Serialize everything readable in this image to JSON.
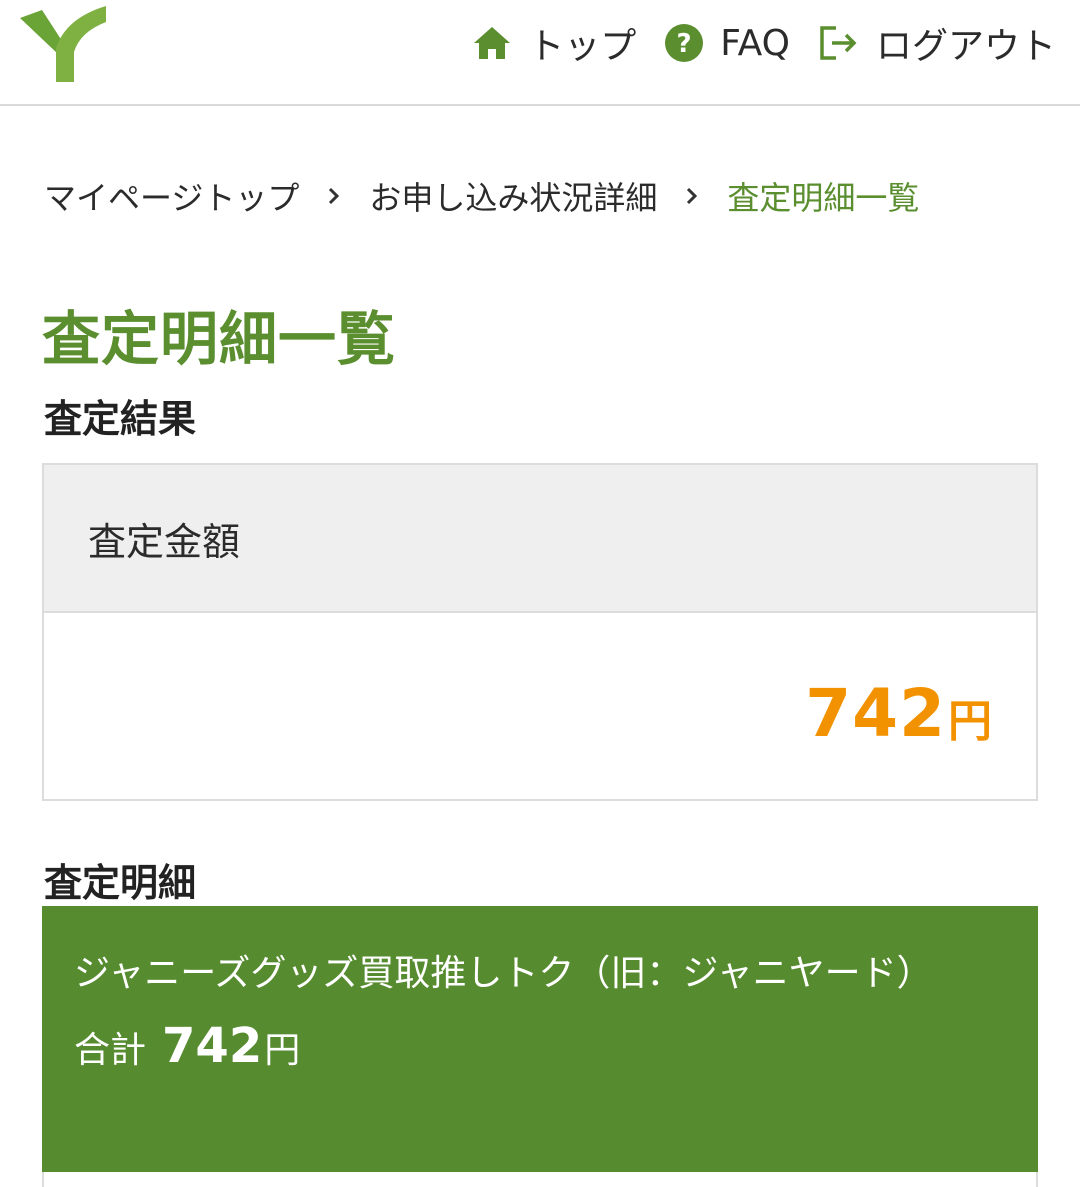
{
  "header": {
    "nav": {
      "top_label": "トップ",
      "faq_label": "FAQ",
      "logout_label": "ログアウト"
    }
  },
  "breadcrumb": {
    "items": [
      "マイページトップ",
      "お申し込み状況詳細",
      "査定明細一覧"
    ]
  },
  "page": {
    "title": "査定明細一覧"
  },
  "result": {
    "section_title": "査定結果",
    "label": "査定金額",
    "amount": "742",
    "unit": "円"
  },
  "details": {
    "section_title": "査定明細",
    "items": [
      {
        "name": "ジャニーズグッズ買取推しトク（旧：ジャニヤード）",
        "total_label": "合計",
        "total_amount": "742",
        "unit": "円"
      }
    ]
  },
  "colors": {
    "brand_green": "#5a8e2f",
    "card_green": "#568b30",
    "amount_orange": "#f39200"
  }
}
